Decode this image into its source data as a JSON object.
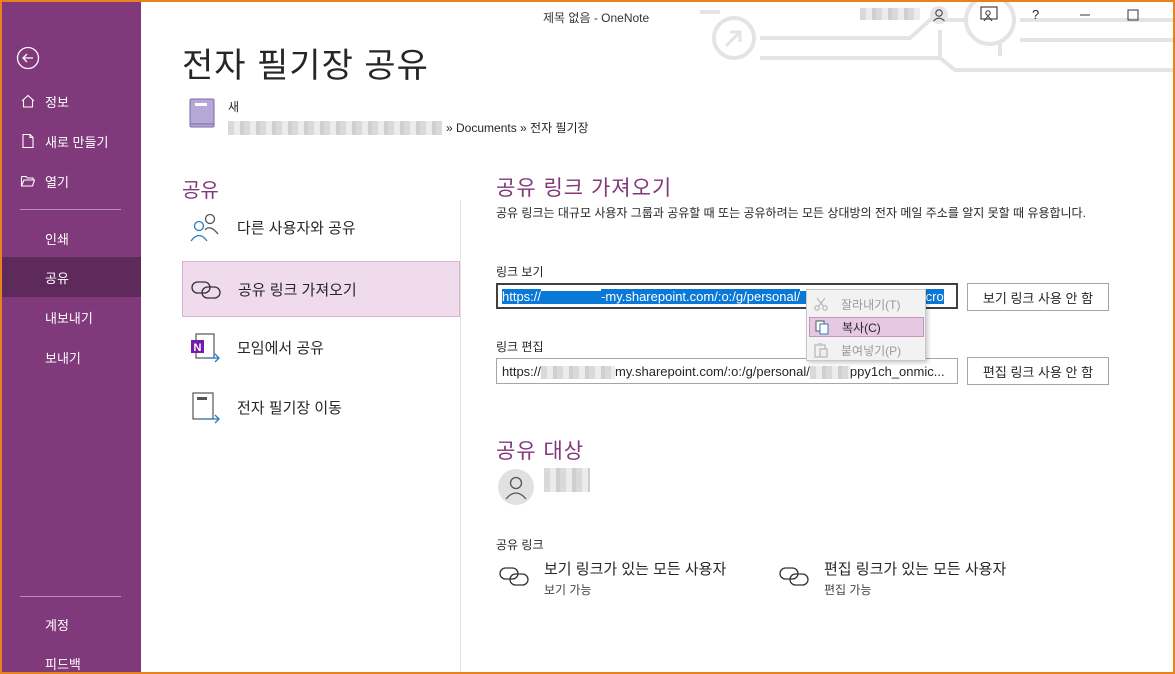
{
  "titlebar": {
    "title": "제목 없음  -  OneNote",
    "help_label": "?"
  },
  "sidebar": {
    "items": [
      {
        "label": "정보",
        "icon": "home-icon"
      },
      {
        "label": "새로 만들기",
        "icon": "new-doc-icon"
      },
      {
        "label": "열기",
        "icon": "folder-open-icon"
      },
      {
        "label": "인쇄"
      },
      {
        "label": "공유",
        "active": true
      },
      {
        "label": "내보내기"
      },
      {
        "label": "보내기"
      },
      {
        "label": "계정"
      },
      {
        "label": "피드백"
      }
    ]
  },
  "header": {
    "title": "전자 필기장 공유",
    "notebook_name": "새",
    "notebook_path": "» Documents » 전자 필기장"
  },
  "share_options": {
    "heading": "공유",
    "items": [
      {
        "label": "다른 사용자와 공유",
        "icon": "people-icon"
      },
      {
        "label": "공유 링크 가져오기",
        "icon": "link-icon",
        "selected": true
      },
      {
        "label": "모임에서 공유",
        "icon": "onenote-meeting-icon"
      },
      {
        "label": "전자 필기장 이동",
        "icon": "move-notebook-icon"
      }
    ]
  },
  "get_link": {
    "heading": "공유 링크 가져오기",
    "description": "공유 링크는 대규모 사용자 그룹과 공유할 때 또는 공유하려는 모든 상대방의 전자 메일 주소를 알지 못할 때 유용합니다.",
    "view_label": "링크 보기",
    "view_link_prefix": "https://",
    "view_link_rest": "-my.sharepoint.com/:o:/g/personal/",
    "view_link_tail": "_onmicro",
    "view_disable": "보기 링크 사용 안 함",
    "edit_label": "링크 편집",
    "edit_link_prefix": "https://",
    "edit_link_rest": "my.sharepoint.com/:o:/g/personal/",
    "edit_link_tail": "ppy1ch_onmic...",
    "edit_disable": "편집 링크 사용 안 함"
  },
  "context_menu": {
    "items": [
      {
        "label": "잘라내기(T)",
        "icon": "scissors-icon",
        "enabled": false
      },
      {
        "label": "복사(C)",
        "icon": "copy-icon",
        "enabled": true,
        "highlighted": true
      },
      {
        "label": "붙여넣기(P)",
        "icon": "paste-icon",
        "enabled": false
      }
    ]
  },
  "shared_with": {
    "heading": "공유 대상",
    "links_label": "공유 링크",
    "view_title": "보기 링크가 있는 모든 사용자",
    "view_sub": "보기 가능",
    "edit_title": "편집 링크가 있는 모든 사용자",
    "edit_sub": "편집 가능"
  },
  "colors": {
    "brand": "#80397b",
    "brand_dark": "#5e2a5b",
    "selection": "#efdbec",
    "highlight": "#0a78d7"
  }
}
